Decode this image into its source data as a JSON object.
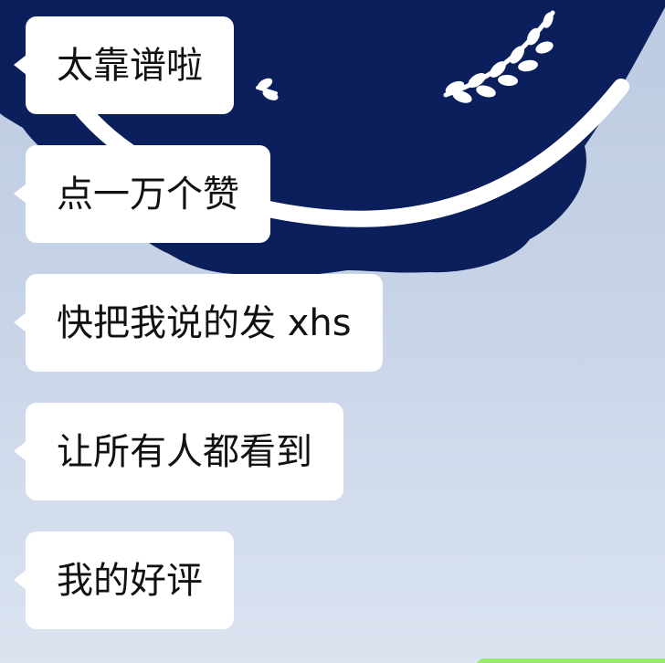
{
  "chat": {
    "messages": [
      {
        "text": "太靠谱啦"
      },
      {
        "text": "点一万个赞"
      },
      {
        "text": "快把我说的发 xhs"
      },
      {
        "text": "让所有人都看到"
      },
      {
        "text": "我的好评"
      }
    ]
  },
  "colors": {
    "wallpaper_navy": "#0b1f5c",
    "bubble": "#ffffff",
    "sent_bubble_green": "#95ec69"
  }
}
